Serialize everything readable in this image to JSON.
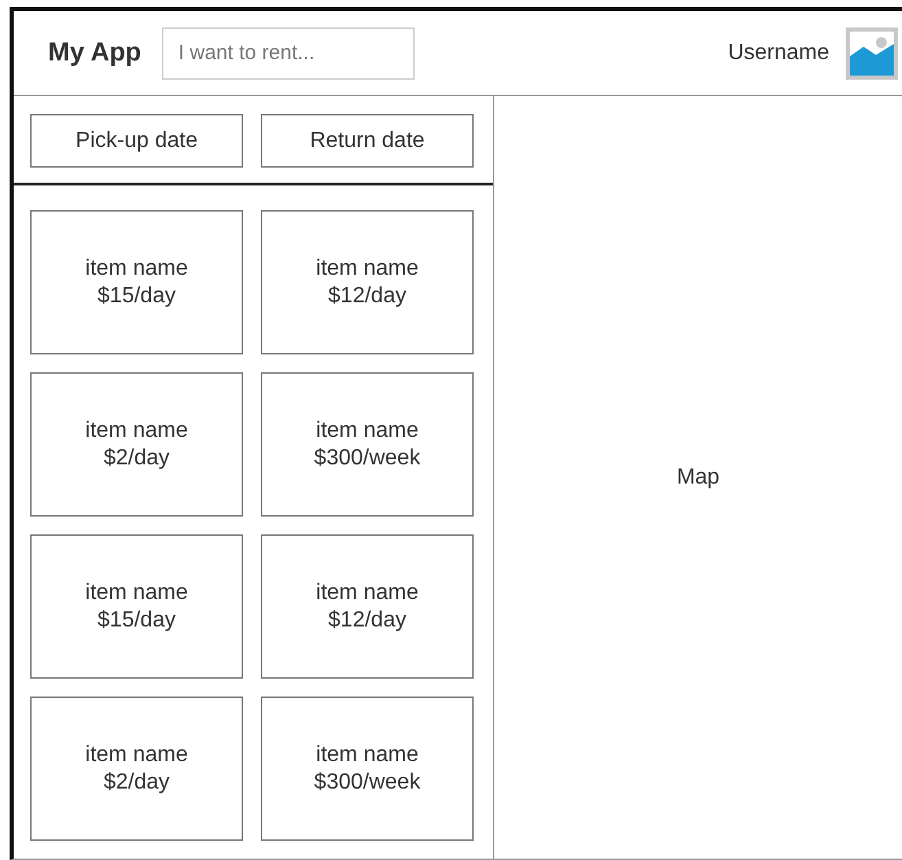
{
  "header": {
    "app_name": "My App",
    "search": {
      "placeholder": "I want to rent..."
    },
    "username": "Username"
  },
  "filters": [
    "Pick-up date",
    "Return date"
  ],
  "items": [
    {
      "name": "item name",
      "price": "$15/day"
    },
    {
      "name": "item name",
      "price": "$12/day"
    },
    {
      "name": "item name",
      "price": "$2/day"
    },
    {
      "name": "item name",
      "price": "$300/week"
    },
    {
      "name": "item name",
      "price": "$15/day"
    },
    {
      "name": "item name",
      "price": "$12/day"
    },
    {
      "name": "item name",
      "price": "$2/day"
    },
    {
      "name": "item name",
      "price": "$300/week"
    }
  ],
  "map": {
    "label": "Map"
  }
}
